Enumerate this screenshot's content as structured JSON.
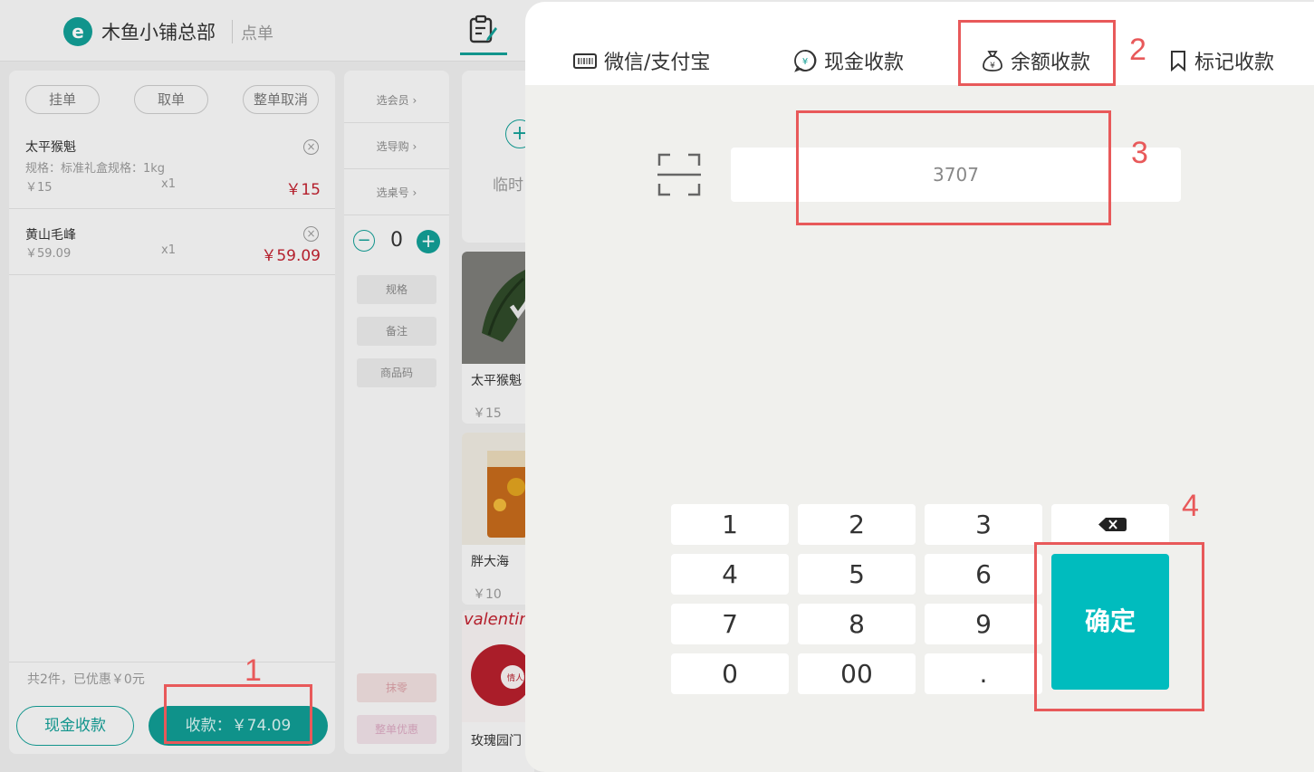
{
  "header": {
    "store_name": "木鱼小铺总部",
    "page_name": "点单"
  },
  "cart": {
    "actions": [
      "挂单",
      "取单",
      "整单取消"
    ],
    "items": [
      {
        "name": "太平猴魁",
        "spec": "规格：标准礼盒规格：1kg",
        "unit_price": "￥15",
        "qty": "x1",
        "total": "￥15"
      },
      {
        "name": "黄山毛峰",
        "spec": "",
        "unit_price": "￥59.09",
        "qty": "x1",
        "total": "￥59.09"
      }
    ],
    "summary": "共2件，已优惠￥0元",
    "cash_button": "现金收款",
    "pay_button": "收款：￥74.09"
  },
  "side_menu": {
    "links": [
      "选会员",
      "选导购",
      "选桌号"
    ],
    "quantity": "0",
    "buttons": [
      "规格",
      "备注",
      "商品码"
    ],
    "bottom_buttons": [
      "抹零",
      "整单优惠"
    ]
  },
  "products": {
    "temp_label": "临时",
    "items": [
      {
        "name": "太平猴魁",
        "price": "￥15"
      },
      {
        "name": "胖大海",
        "price": "￥10"
      },
      {
        "name": "玫瑰园门",
        "price": ""
      }
    ],
    "valentine_text": "valentin",
    "valentine_badge": "情人节"
  },
  "payment": {
    "tabs": [
      {
        "label": "微信/支付宝",
        "icon": "barcode-card-icon"
      },
      {
        "label": "现金收款",
        "icon": "yuan-coin-icon"
      },
      {
        "label": "余额收款",
        "icon": "money-bag-icon",
        "active": true
      },
      {
        "label": "标记收款",
        "icon": "bookmark-icon"
      }
    ],
    "amount_value": "3707",
    "keypad": [
      "1",
      "2",
      "3",
      "4",
      "5",
      "6",
      "7",
      "8",
      "9",
      "0",
      "00",
      "."
    ],
    "confirm_label": "确定"
  },
  "annotations": {
    "labels": [
      "1",
      "2",
      "3",
      "4"
    ],
    "color": "#e8595a"
  },
  "colors": {
    "brand": "#139e95",
    "confirm": "#00bcbe",
    "price_red": "#c0212f"
  }
}
